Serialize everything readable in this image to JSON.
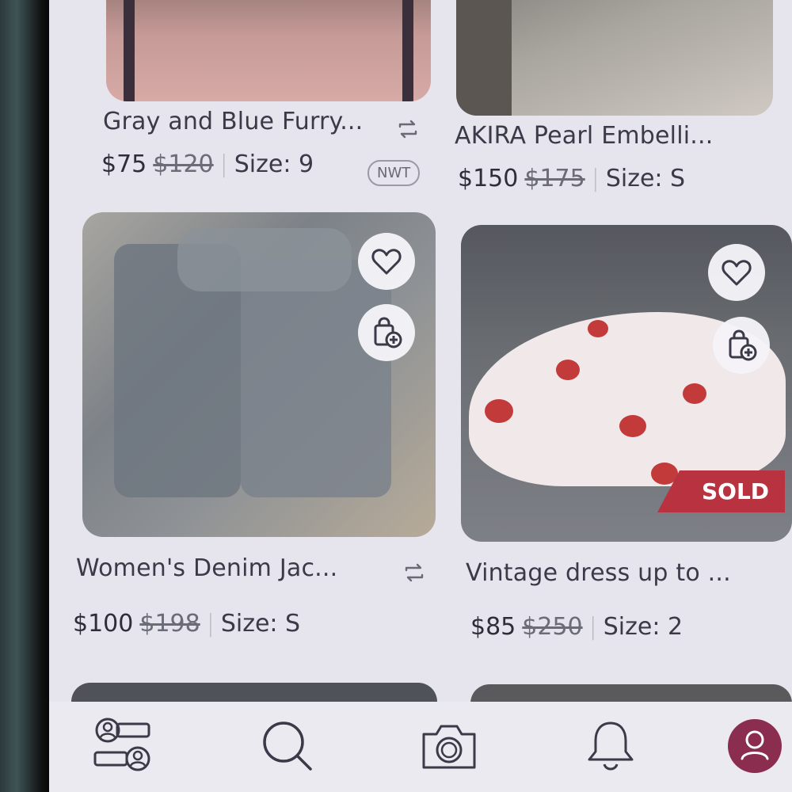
{
  "listings": [
    {
      "title": "Gray and Blue Furry...",
      "price": "$75",
      "original_price": "$120",
      "size": "Size: 9",
      "badge": "NWT"
    },
    {
      "title": "AKIRA Pearl Embelli...",
      "price": "$150",
      "original_price": "$175",
      "size": "Size: S"
    },
    {
      "title": "Women's Denim Jac...",
      "price": "$100",
      "original_price": "$198",
      "size": "Size: S"
    },
    {
      "title": "Vintage dress up to ...",
      "price": "$85",
      "original_price": "$250",
      "size": "Size: 2",
      "status": "SOLD"
    }
  ],
  "separator": "|",
  "bottom_nav": {
    "items": [
      "community-icon",
      "search-icon",
      "camera-icon",
      "bell-icon",
      "profile-icon"
    ],
    "active": "profile-icon"
  },
  "colors": {
    "accent": "#8a2d4f",
    "sold_banner": "#b8323f",
    "screen_bg": "#e6e4ec"
  }
}
